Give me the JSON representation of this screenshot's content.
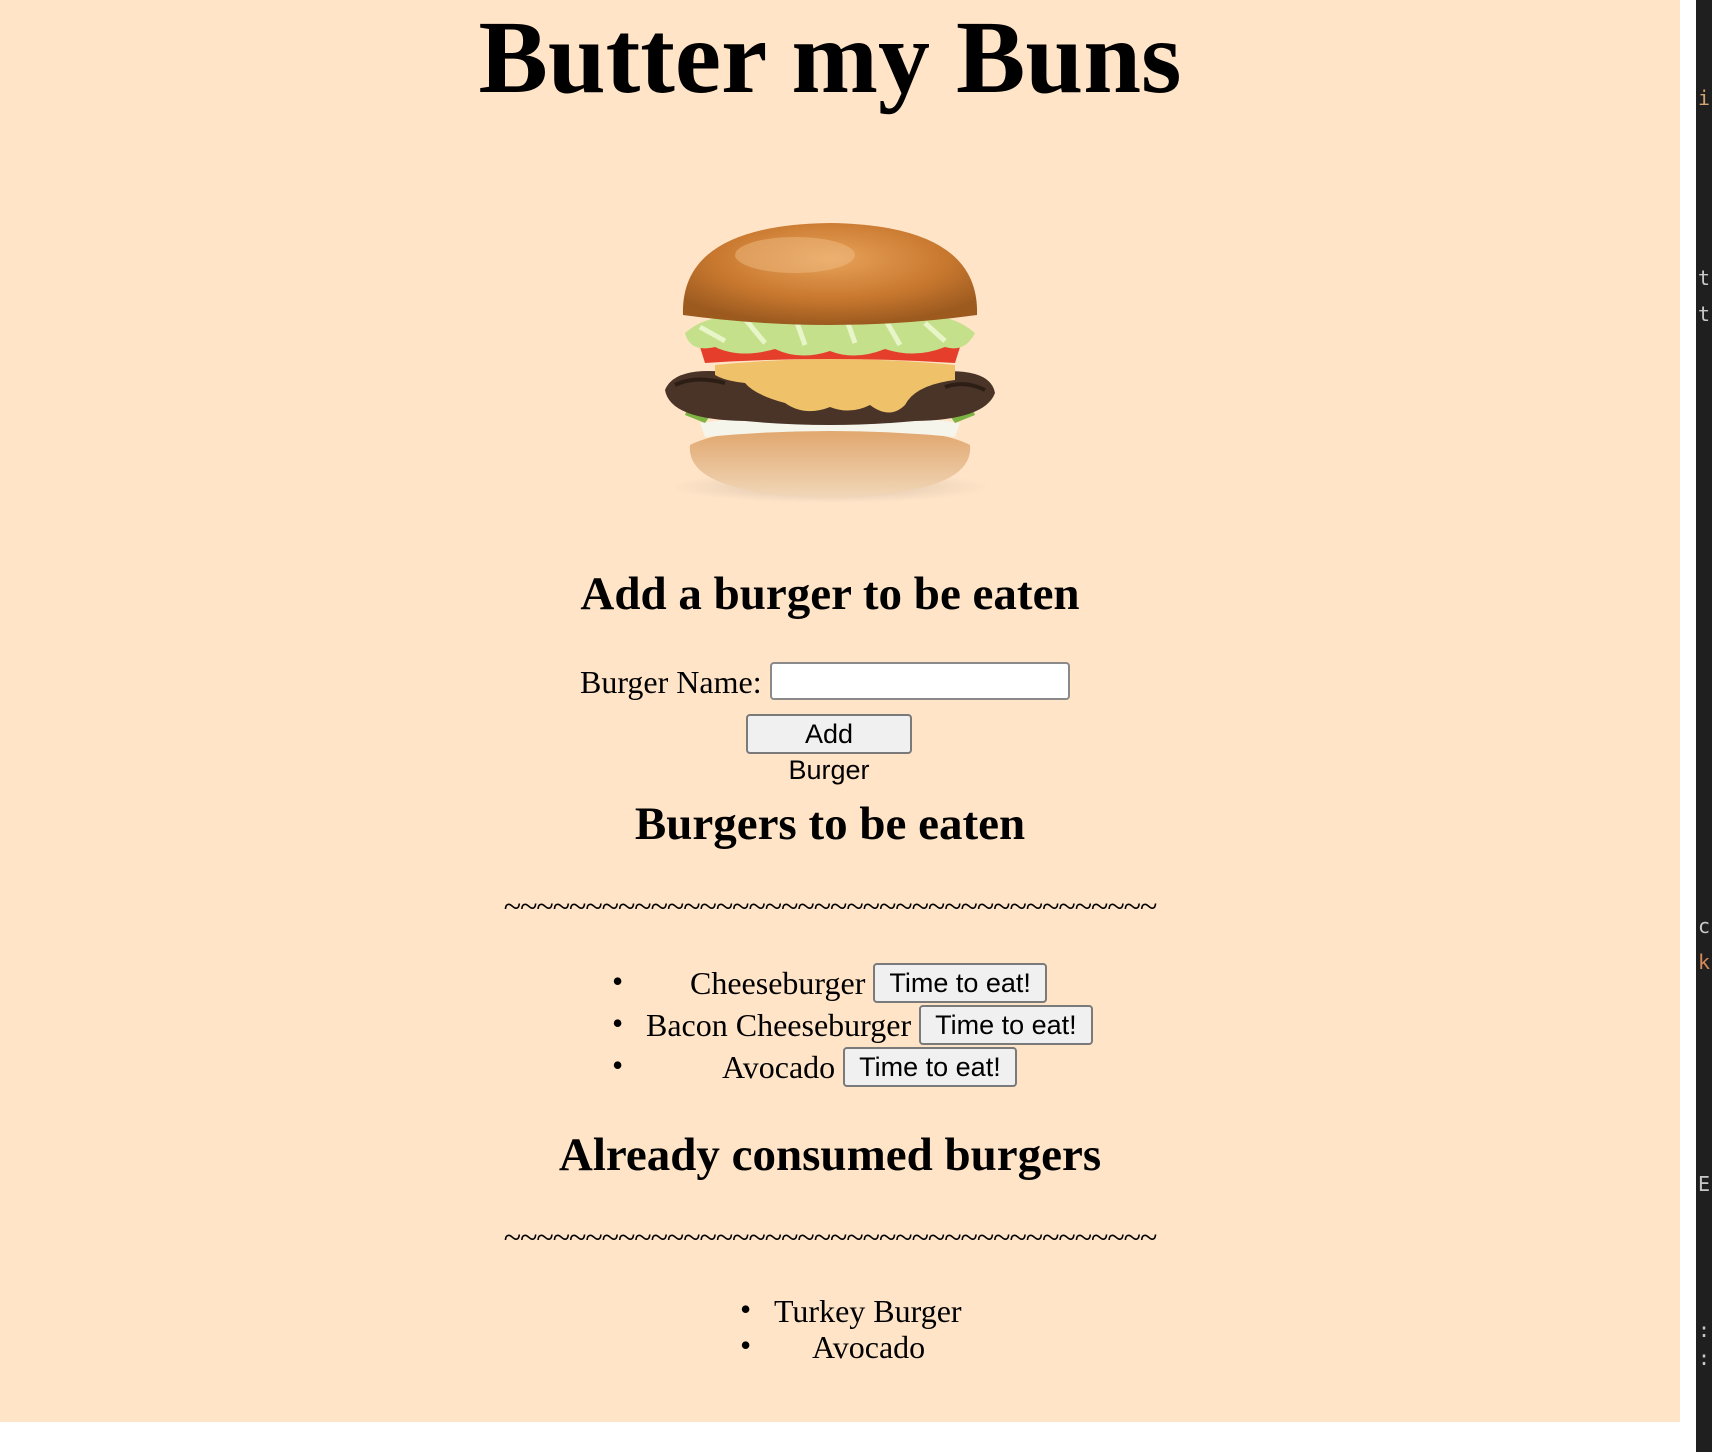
{
  "page": {
    "title": "Butter my Buns",
    "background": "#FFE4C8"
  },
  "add_section": {
    "heading": "Add a burger to be eaten",
    "label": "Burger Name:",
    "input_value": "",
    "button_label": "Add Burger"
  },
  "to_eat": {
    "heading": "Burgers to be eaten",
    "divider": "~~~~~~~~~~~~~~~~~~~~~~~~~~~~~~~~~~~~~~~~",
    "items": [
      {
        "name": "Cheeseburger",
        "button": "Time to eat!"
      },
      {
        "name": "Bacon Cheeseburger",
        "button": "Time to eat!"
      },
      {
        "name": "Avocado",
        "button": "Time to eat!"
      }
    ]
  },
  "consumed": {
    "heading": "Already consumed burgers",
    "divider": "~~~~~~~~~~~~~~~~~~~~~~~~~~~~~~~~~~~~~~~~",
    "items": [
      {
        "name": "Turkey Burger"
      },
      {
        "name": "Avocado"
      }
    ]
  },
  "bullet_char": "•",
  "editor_fragments": [
    "i",
    "t",
    "t",
    "c",
    "k",
    "E",
    ":",
    ":"
  ],
  "icons": {
    "hero": "burger-image"
  }
}
